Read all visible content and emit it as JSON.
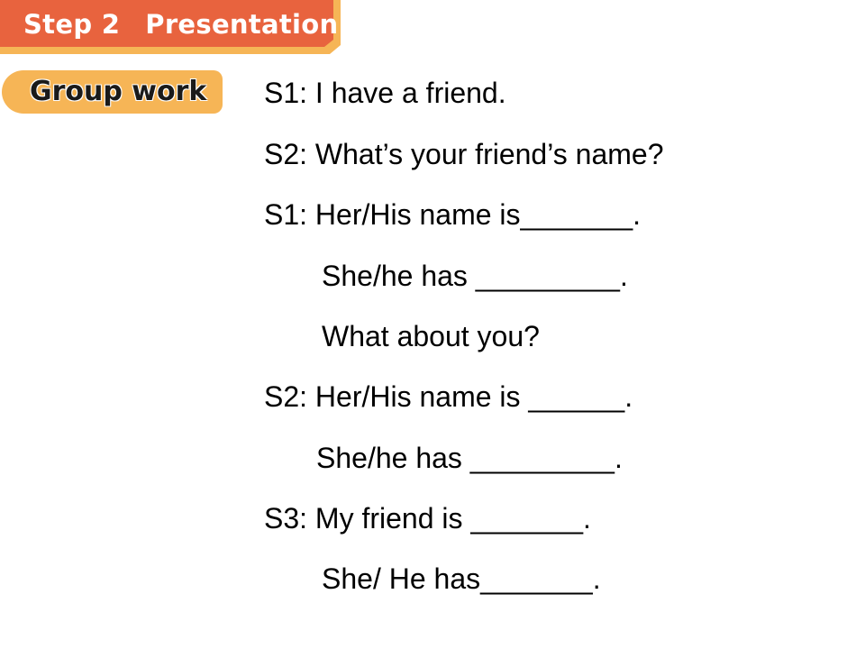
{
  "header": {
    "step_label": "Step 2",
    "section_title": "Presentation"
  },
  "activity": {
    "label": "Group work"
  },
  "dialogue": [
    "S1: I have a friend.",
    "S2: What’s your friend’s name?",
    "S1: Her/His name is_______.",
    "She/he has _________.",
    "What about you?",
    "S2: Her/His name is ______.",
    "She/he has _________.",
    "S3: My friend is _______.",
    "She/ He has_______."
  ],
  "colors": {
    "banner": "#e8633e",
    "banner_edge": "#f6b556",
    "pill": "#f6b556"
  }
}
